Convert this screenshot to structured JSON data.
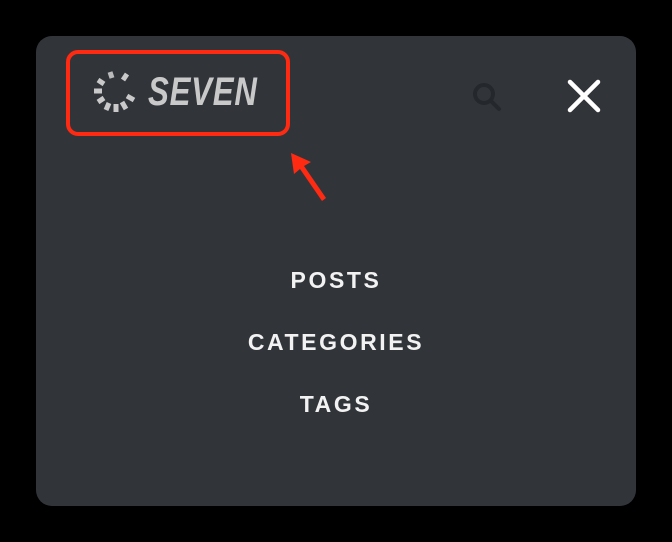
{
  "header": {
    "logo_text": "SEVEN",
    "logo_icon": "spinner-logo-icon",
    "search_icon": "search-icon",
    "close_icon": "close-icon"
  },
  "nav": {
    "items": [
      {
        "label": "POSTS"
      },
      {
        "label": "CATEGORIES"
      },
      {
        "label": "TAGS"
      }
    ]
  },
  "colors": {
    "panel_bg": "#31353a",
    "outer_bg": "#000000",
    "annotation": "#ff2a12",
    "nav_text": "#f2f2f2",
    "logo_text": "#c9c9c9",
    "search_icon": "#24282c"
  }
}
